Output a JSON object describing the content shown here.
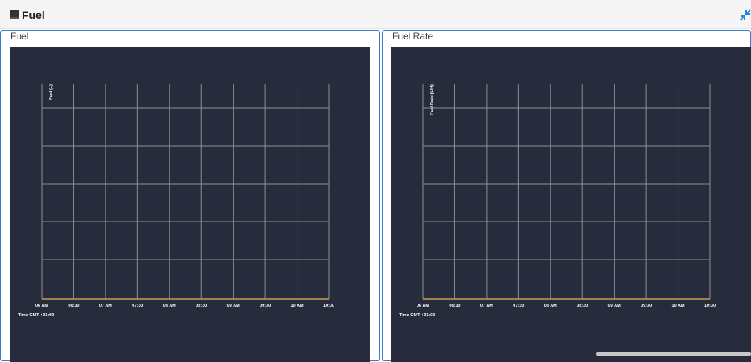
{
  "header": {
    "title": "Fuel",
    "icon": "dashboard-square-icon",
    "collapse_icon": "compress-arrows-icon",
    "collapse_color": "#1e88e5"
  },
  "panels": [
    {
      "title": "Fuel"
    },
    {
      "title": "Fuel Rate"
    }
  ],
  "colors": {
    "chart_background": "#272c3c",
    "grid": "#8a8f9c",
    "baseline": "#c8a050",
    "text": "#ffffff"
  },
  "chart_data": [
    {
      "type": "line",
      "title": "",
      "ylabel": "Fuel (L)",
      "xlabel": "Time GMT +01:00",
      "x_ticks": [
        "06 AM",
        "06:30",
        "07 AM",
        "07:30",
        "08 AM",
        "08:30",
        "09 AM",
        "09:30",
        "10 AM",
        "10:30"
      ],
      "series": [],
      "grid": true
    },
    {
      "type": "line",
      "title": "",
      "ylabel": "Fuel Rate (L/H)",
      "xlabel": "Time GMT +01:00",
      "x_ticks": [
        "06 AM",
        "06:30",
        "07 AM",
        "07:30",
        "08 AM",
        "08:30",
        "09 AM",
        "09:30",
        "10 AM",
        "10:30"
      ],
      "series": [],
      "grid": true
    }
  ]
}
